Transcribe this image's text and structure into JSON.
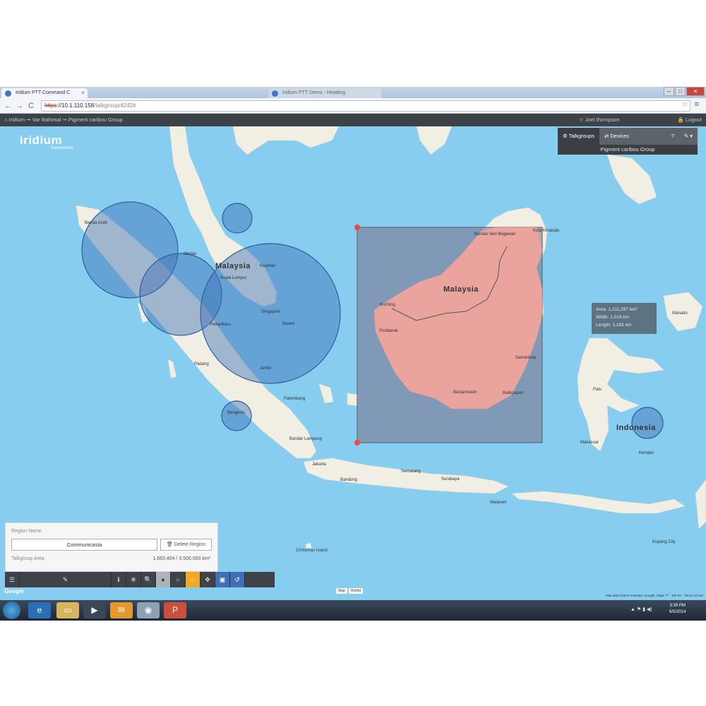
{
  "browser": {
    "active_tab": "Iridium PTT Command C",
    "inactive_tab": "Iridium PTT Demo - Heading",
    "url_proto": "https",
    "url_host": "://10.1.110.158",
    "url_path": "/talkgroup/4242#",
    "window_controls": [
      "–",
      "□",
      "✕"
    ]
  },
  "appbar": {
    "breadcrumb": "⌂ Iridium ➞ Var Rahimal ➞ Pigment caribou Group",
    "user": "☆ Joel thompson",
    "logout": "🔒 Logout"
  },
  "logo": {
    "name": "iridium",
    "tagline": "Everywhere"
  },
  "right_panel": {
    "tabs": [
      "⚙ Talkgroups",
      "⇄ Devices",
      "?",
      "✎ ▾"
    ],
    "subtitle": "Pigment caribou Group"
  },
  "tooltip": {
    "area": "Area: 1,211,297 km²",
    "width": "Width: 1,019 km",
    "length": "Length: 1,183 km"
  },
  "region_panel": {
    "label": "Region Name",
    "name": "Communicasia",
    "delete": "🗑 Delete Region",
    "area_label": "Talkgroup Area",
    "area_value": "1,683,404 / 3,500,000 km²"
  },
  "toolbar": {
    "icons": [
      "☰",
      "✎",
      "ℹ",
      "⛯",
      "🔍",
      "●",
      "○",
      "☆",
      "✥",
      "▣",
      "↺"
    ]
  },
  "map": {
    "countries": [
      "Malaysia",
      "Malaysia",
      "Indonesia"
    ],
    "labels": [
      "Banda Aceh",
      "Medan",
      "Kuala Lumpur",
      "Kuantan",
      "Singapore",
      "Batam",
      "Pekanbaru",
      "Jambi",
      "Padang",
      "Palembang",
      "Bengkulu",
      "Bandar Lampung",
      "Jakarta",
      "Bandung",
      "Semarang",
      "Surabaya",
      "Kuching",
      "Pontianak",
      "Banjarmasin",
      "Balikpapan",
      "Samarinda",
      "Bandar Seri Begawan",
      "Kota Kinabalu",
      "Makassar",
      "Kendari",
      "Christmas Island",
      "Palu",
      "Manado",
      "Kupang City",
      "Mataram"
    ],
    "google": "Google",
    "map_types": [
      "Map",
      "Hybrid"
    ],
    "attribution": "Map data ©2014 AutoNavi, Google, Maps ™ · 100 km · Terms of Use"
  },
  "taskbar": {
    "time": "3:39 PM",
    "date": "6/5/2014"
  },
  "colors": {
    "water": "#86cdf0",
    "land": "#f1eee4",
    "circle": "#3f6fb3",
    "rect_fill": "#7a7086",
    "appbar": "#3e4247"
  }
}
